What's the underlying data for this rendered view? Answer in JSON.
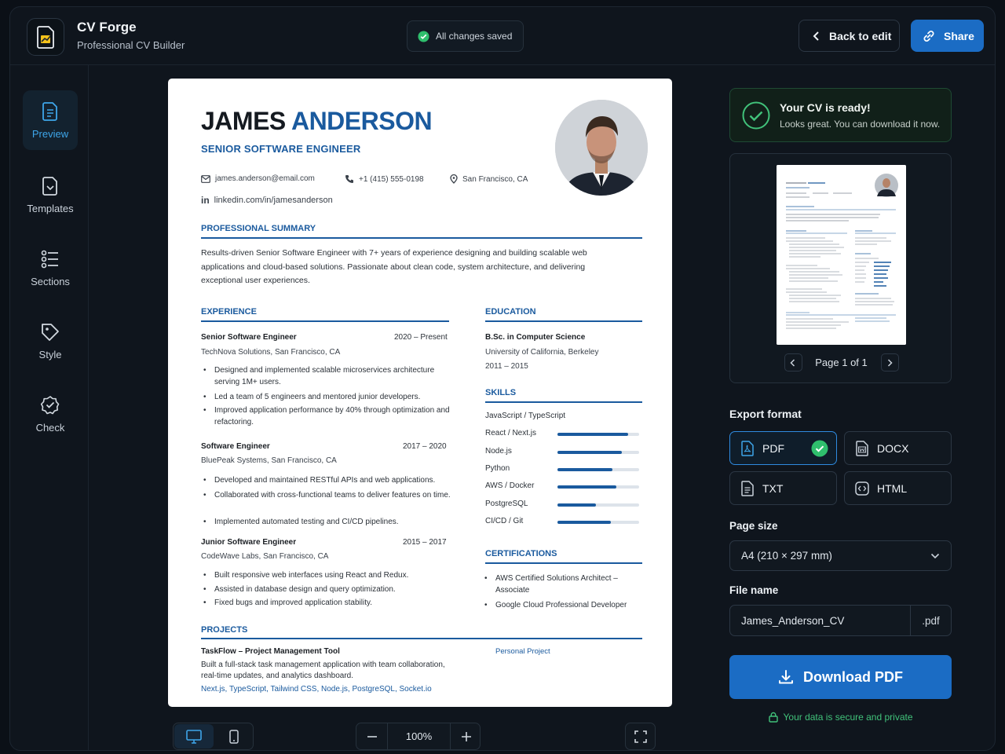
{
  "header": {
    "app_name": "CV Forge",
    "app_subtitle": "Professional CV Builder",
    "save_status": "All changes saved",
    "back_label": "Back to edit",
    "share_label": "Share"
  },
  "sidebar": {
    "items": [
      {
        "label": "Preview",
        "icon": "preview-icon",
        "active": true
      },
      {
        "label": "Templates",
        "icon": "templates-icon"
      },
      {
        "label": "Sections",
        "icon": "sections-icon"
      },
      {
        "label": "Style",
        "icon": "style-icon"
      },
      {
        "label": "Check",
        "icon": "check-icon"
      }
    ]
  },
  "resume": {
    "first_name": "JAMES",
    "last_name": "ANDERSON",
    "role": "SENIOR SOFTWARE ENGINEER",
    "email": "james.anderson@email.com",
    "phone": "+1 (415) 555-0198",
    "location": "San Francisco, CA",
    "linkedin": "linkedin.com/in/jamesanderson",
    "summary_title": "PROFESSIONAL SUMMARY",
    "summary": "Results-driven Senior Software Engineer with 7+ years of experience designing and building scalable web applications and cloud-based solutions. Passionate about clean code, system architecture, and delivering exceptional user experiences.",
    "experience_title": "EXPERIENCE",
    "experience": [
      {
        "title": "Senior Software Engineer",
        "dates": "2020 – Present",
        "company": "TechNova Solutions, San Francisco, CA",
        "bullets": [
          "Designed and implemented scalable microservices architecture serving 1M+ users.",
          "Led a team of 5 engineers and mentored junior developers.",
          "Improved application performance by 40% through optimization and refactoring."
        ]
      },
      {
        "title": "Software Engineer",
        "dates": "2017 – 2020",
        "company": "BluePeak Systems, San Francisco, CA",
        "bullets": [
          "Developed and maintained RESTful APIs and web applications.",
          "Collaborated with cross-functional teams to deliver features on time.",
          "Implemented automated testing and CI/CD pipelines."
        ]
      },
      {
        "title": "Junior Software Engineer",
        "dates": "2015 – 2017",
        "company": "CodeWave Labs, San Francisco, CA",
        "bullets": [
          "Built responsive web interfaces using React and Redux.",
          "Assisted in database design and query optimization.",
          "Fixed bugs and improved application stability."
        ]
      }
    ],
    "education_title": "EDUCATION",
    "education": {
      "degree": "B.Sc. in Computer Science",
      "school": "University of California, Berkeley",
      "years": "2011 – 2015"
    },
    "skills_title": "SKILLS",
    "skills": [
      {
        "name": "JavaScript / TypeScript",
        "level": 0.95
      },
      {
        "name": "React / Next.js",
        "level": 0.87
      },
      {
        "name": "Node.js",
        "level": 0.79
      },
      {
        "name": "Python",
        "level": 0.67
      },
      {
        "name": "AWS / Docker",
        "level": 0.72
      },
      {
        "name": "PostgreSQL",
        "level": 0.47
      },
      {
        "name": "CI/CD / Git",
        "level": 0.65
      }
    ],
    "certifications_title": "CERTIFICATIONS",
    "certifications": [
      "AWS Certified Solutions Architect – Associate",
      "Google Cloud Professional Developer"
    ],
    "projects_title": "PROJECTS",
    "project": {
      "name": "TaskFlow – Project Management Tool",
      "tag": "Personal Project",
      "description": "Built a full-stack task management application with team collaboration, real-time updates, and analytics dashboard.",
      "stack": "Next.js, TypeScript, Tailwind CSS, Node.js, PostgreSQL, Socket.io"
    }
  },
  "viewer": {
    "zoom": "100%"
  },
  "panel": {
    "ready_title": "Your CV is ready!",
    "ready_subtitle": "Looks great. You can download it now.",
    "page_indicator": "Page 1 of 1",
    "export_label": "Export format",
    "formats": [
      {
        "label": "PDF",
        "selected": true
      },
      {
        "label": "DOCX"
      },
      {
        "label": "TXT"
      },
      {
        "label": "HTML"
      }
    ],
    "page_size_label": "Page size",
    "page_size_value": "A4 (210 × 297 mm)",
    "file_name_label": "File name",
    "file_name_value": "James_Anderson_CV",
    "file_ext": ".pdf",
    "download_label": "Download PDF",
    "secure_text": "Your data is secure and private"
  },
  "colors": {
    "accent": "#1b6cc4",
    "resume_accent": "#1a5a9e",
    "success": "#41c27a"
  }
}
